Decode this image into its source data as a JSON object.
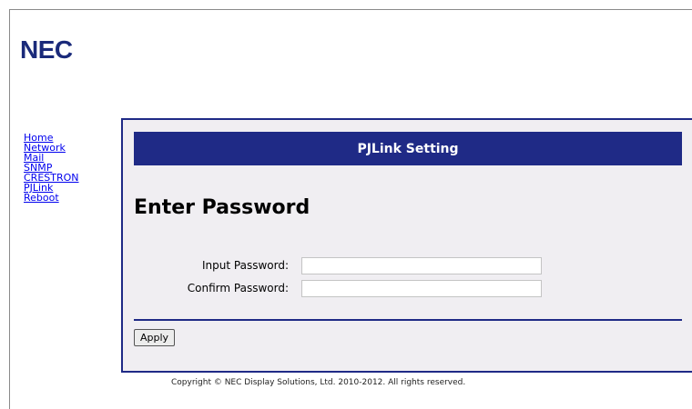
{
  "brand": {
    "logo_text": "NEC",
    "color": "#1a2a7a"
  },
  "nav": {
    "items": [
      {
        "label": "Home"
      },
      {
        "label": "Network"
      },
      {
        "label": "Mail"
      },
      {
        "label": "SNMP"
      },
      {
        "label": "CRESTRON"
      },
      {
        "label": "PJLink"
      },
      {
        "label": "Reboot"
      }
    ]
  },
  "panel": {
    "header": "PJLink Setting",
    "title": "Enter Password",
    "accent_color": "#1f2a86",
    "fields": [
      {
        "label": "Input Password:",
        "value": ""
      },
      {
        "label": "Confirm Password:",
        "value": ""
      }
    ],
    "apply_label": "Apply"
  },
  "footer": {
    "copyright": "Copyright © NEC Display Solutions, Ltd. 2010-2012. All rights reserved."
  }
}
